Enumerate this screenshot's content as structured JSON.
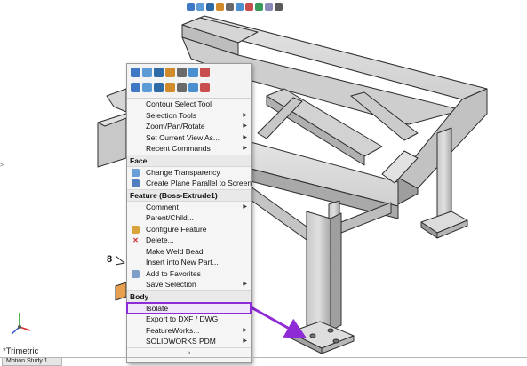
{
  "view": {
    "orientation_label": "*Trimetric",
    "bottom_tab": "Motion Study 1",
    "dimension_label": "8"
  },
  "hud_icons": [
    "zoom-fit-icon",
    "zoom-area-icon",
    "previous-view-icon",
    "section-view-icon",
    "view-orientation-icon",
    "display-style-icon",
    "hide-show-icon",
    "edit-appearance-icon",
    "apply-scene-icon",
    "view-settings-icon"
  ],
  "context_toolbar": {
    "row1": [
      "appearance-icon",
      "sketch-icon",
      "smart-dimension-icon",
      "zoom-icon",
      "undo-icon",
      "view-icon",
      "rebuild-icon"
    ],
    "row2": [
      "normal-to-icon",
      "sketch-plane-icon",
      "hide-icon",
      "zoom-selection-icon",
      "isometric-icon",
      "shaded-icon",
      "edges-icon"
    ]
  },
  "menu": {
    "general": [
      {
        "label": "Contour Select Tool"
      },
      {
        "label": "Selection Tools",
        "submenu": true
      },
      {
        "label": "Zoom/Pan/Rotate",
        "submenu": true
      },
      {
        "label": "Set Current View As...",
        "submenu": true
      },
      {
        "label": "Recent Commands",
        "submenu": true
      }
    ],
    "face_header": "Face",
    "face": [
      {
        "label": "Change Transparency"
      },
      {
        "label": "Create Plane Parallel to Screen"
      }
    ],
    "feature_header": "Feature (Boss-Extrude1)",
    "feature": [
      {
        "label": "Comment",
        "submenu": true
      },
      {
        "label": "Parent/Child..."
      },
      {
        "label": "Configure Feature"
      },
      {
        "label": "Delete..."
      },
      {
        "label": "Make Weld Bead"
      },
      {
        "label": "Insert into New Part..."
      },
      {
        "label": "Add to Favorites"
      },
      {
        "label": "Save Selection",
        "submenu": true
      }
    ],
    "body_header": "Body",
    "body": [
      {
        "label": "Isolate"
      },
      {
        "label": "Export to DXF / DWG"
      },
      {
        "label": "FeatureWorks...",
        "submenu": true
      },
      {
        "label": "SOLIDWORKS PDM",
        "submenu": true
      }
    ],
    "more_glyph": "»",
    "submenu_glyph": "▶"
  },
  "colors": {
    "highlight": "#8e2bd6",
    "steel_light": "#d9d9d9",
    "steel_mid": "#b9b9b9",
    "steel_dark": "#8a8a8a"
  }
}
